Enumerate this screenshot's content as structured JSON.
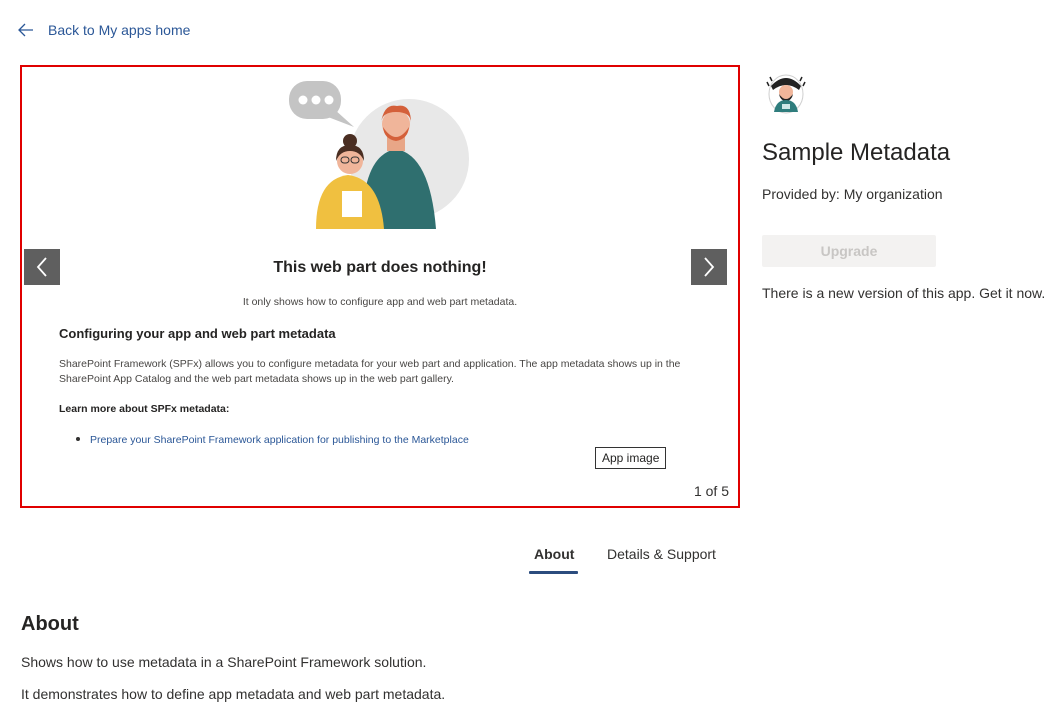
{
  "header": {
    "back_label": "Back to My apps home"
  },
  "carousel": {
    "slide": {
      "title": "This web part does nothing!",
      "subtitle": "It only shows how to configure app and web part metadata.",
      "heading": "Configuring your app and web part metadata",
      "body": "SharePoint Framework (SPFx) allows you to configure metadata for your web part and application. The app metadata shows up in the SharePoint App Catalog and the web part metadata shows up in the web part gallery.",
      "learn_more": "Learn more about SPFx metadata:",
      "bullet_link": "Prepare your SharePoint Framework application for publishing to the Marketplace"
    },
    "tooltip": "App image",
    "counter": "1 of 5",
    "accent_color": "#e00000"
  },
  "app": {
    "title": "Sample Metadata",
    "provided_by": "Provided by: My organization",
    "upgrade_label": "Upgrade",
    "new_version_text": "There is a new version of this app. Get it now."
  },
  "tabs": [
    {
      "label": "About",
      "selected": true
    },
    {
      "label": "Details & Support",
      "selected": false
    }
  ],
  "about": {
    "heading": "About",
    "lines": [
      "Shows how to use metadata in a SharePoint Framework solution.",
      "It demonstrates how to define app metadata and web part metadata."
    ]
  },
  "icons": {
    "back": "arrow-left-icon",
    "prev": "chevron-left-icon",
    "next": "chevron-right-icon",
    "app": "app-logo-icon"
  },
  "colors": {
    "link": "#2b5797",
    "tab_underline": "#2b4c7e",
    "nav_button": "#5f5f5f"
  }
}
